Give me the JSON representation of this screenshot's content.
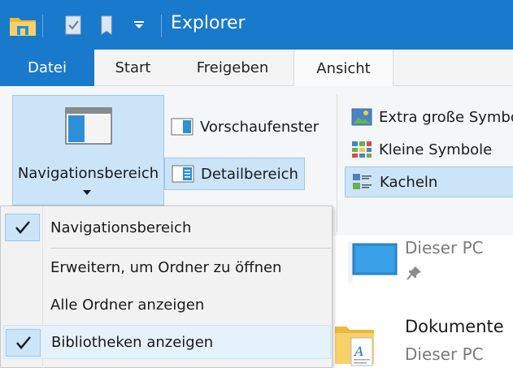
{
  "window": {
    "title": "Explorer",
    "accent_color": "#1979ca"
  },
  "quick_access": {
    "icons": [
      "folder-icon",
      "properties-icon",
      "new-folder-icon",
      "customize-dropdown-icon"
    ]
  },
  "tabs": [
    {
      "label": "Datei"
    },
    {
      "label": "Start"
    },
    {
      "label": "Freigeben"
    },
    {
      "label": "Ansicht"
    }
  ],
  "panes_group": {
    "navigation_button": "Navigationsbereich",
    "preview_button": "Vorschaufenster",
    "details_button": "Detailbereich"
  },
  "layout_group": {
    "items": [
      {
        "label": "Extra große Symbole"
      },
      {
        "label": "Kleine Symbole"
      },
      {
        "label": "Kacheln"
      }
    ]
  },
  "dropdown": {
    "items": [
      {
        "label": "Navigationsbereich",
        "checked": true
      },
      {
        "label": "Erweitern, um Ordner zu öffnen",
        "checked": false
      },
      {
        "label": "Alle Ordner anzeigen",
        "checked": false
      },
      {
        "label": "Bibliotheken anzeigen",
        "checked": true
      }
    ]
  },
  "content": {
    "items": [
      {
        "title": "",
        "subtitle": "Dieser PC"
      },
      {
        "title": "Dokumente",
        "subtitle": "Dieser PC"
      }
    ]
  }
}
